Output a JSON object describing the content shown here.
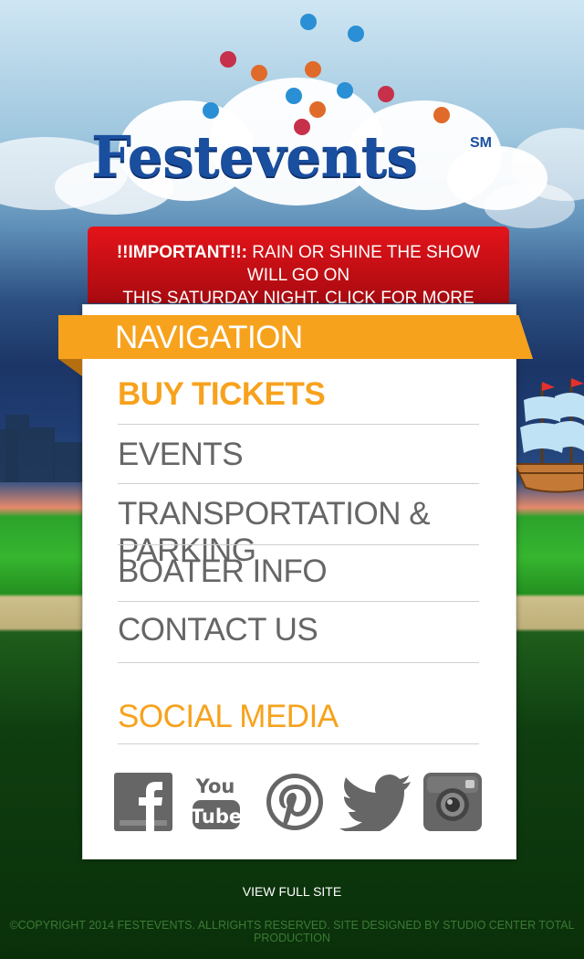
{
  "brand": {
    "name": "Festevents",
    "mark": "SM"
  },
  "alert": {
    "label": "!!IMPORTANT!!:",
    "message_line1": " RAIN OR SHINE THE SHOW WILL GO ON",
    "message_line2": "THIS SATURDAY NIGHT. CLICK FOR MORE DETAILS"
  },
  "nav": {
    "title": "NAVIGATION",
    "items": [
      {
        "label": "BUY TICKETS",
        "active": true
      },
      {
        "label": "EVENTS",
        "active": false
      },
      {
        "label": "TRANSPORTATION & PARKING",
        "active": false
      },
      {
        "label": "BOATER INFO",
        "active": false
      },
      {
        "label": "CONTACT US",
        "active": false
      }
    ]
  },
  "social": {
    "title": "SOCIAL MEDIA",
    "icons": [
      "facebook-icon",
      "youtube-icon",
      "pinterest-icon",
      "twitter-icon",
      "instagram-icon"
    ]
  },
  "footer": {
    "full_site": "VIEW FULL SITE",
    "copyright": "©COPYRIGHT 2014 FESTEVENTS. ALLRIGHTS RESERVED. SITE DESIGNED BY STUDIO CENTER TOTAL PRODUCTION"
  },
  "colors": {
    "accent": "#f7a21d",
    "alert_red": "#d4121a",
    "logo_blue": "#1a4fa0",
    "menu_text": "#666666"
  }
}
